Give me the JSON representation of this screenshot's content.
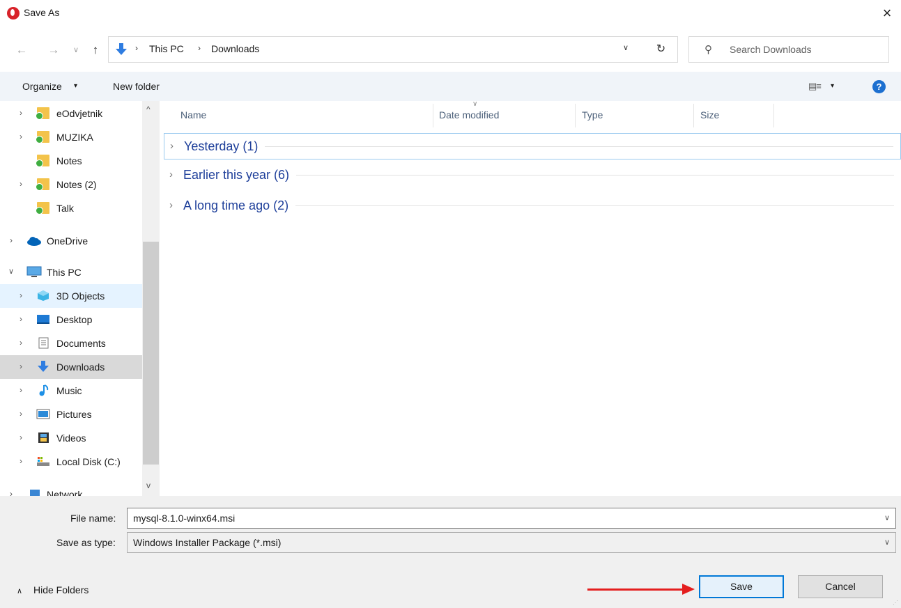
{
  "window": {
    "title": "Save As",
    "close_icon": "close-icon"
  },
  "nav": {
    "back_glyph": "←",
    "forward_glyph": "→",
    "recent_glyph": "∨",
    "up_glyph": "↑",
    "breadcrumb": [
      "This PC",
      "Downloads"
    ],
    "separator": "›",
    "dropdown_glyph": "∨",
    "refresh_glyph": "↻"
  },
  "search": {
    "placeholder": "Search Downloads",
    "icon": "search-icon"
  },
  "commandbar": {
    "organize_label": "Organize",
    "caret": "▾",
    "new_folder_label": "New folder",
    "help_label": "?",
    "view_icon": "view-options-icon"
  },
  "sidebar": {
    "items": [
      {
        "label": "eOdvjetnik",
        "chevron": "›",
        "icon": "shared-folder-icon"
      },
      {
        "label": "MUZIKA",
        "chevron": "›",
        "icon": "shared-folder-icon"
      },
      {
        "label": "Notes",
        "chevron": "",
        "icon": "shared-folder-icon"
      },
      {
        "label": "Notes (2)",
        "chevron": "›",
        "icon": "shared-folder-icon"
      },
      {
        "label": "Talk",
        "chevron": "",
        "icon": "shared-folder-icon"
      },
      {
        "label": "OneDrive",
        "chevron": "›",
        "icon": "cloud-icon"
      },
      {
        "label": "This PC",
        "chevron": "∨",
        "icon": "computer-icon"
      },
      {
        "label": "3D Objects",
        "chevron": "›",
        "icon": "cube-icon"
      },
      {
        "label": "Desktop",
        "chevron": "›",
        "icon": "desktop-icon"
      },
      {
        "label": "Documents",
        "chevron": "›",
        "icon": "document-icon"
      },
      {
        "label": "Downloads",
        "chevron": "›",
        "icon": "download-icon"
      },
      {
        "label": "Music",
        "chevron": "›",
        "icon": "music-icon"
      },
      {
        "label": "Pictures",
        "chevron": "›",
        "icon": "pictures-icon"
      },
      {
        "label": "Videos",
        "chevron": "›",
        "icon": "video-icon"
      },
      {
        "label": "Local Disk (C:)",
        "chevron": "›",
        "icon": "disk-icon"
      },
      {
        "label": "Network",
        "chevron": "›",
        "icon": "network-icon"
      }
    ],
    "scroll_up": "^",
    "scroll_down": "v"
  },
  "columns": {
    "name": "Name",
    "date": "Date modified",
    "type": "Type",
    "size": "Size",
    "sort_caret": "∨"
  },
  "groups": [
    {
      "label": "Yesterday (1)",
      "chevron": "›"
    },
    {
      "label": "Earlier this year (6)",
      "chevron": "›"
    },
    {
      "label": "A long time ago (2)",
      "chevron": "›"
    }
  ],
  "form": {
    "file_name_label": "File name:",
    "file_name_value": "mysql-8.1.0-winx64.msi",
    "save_type_label": "Save as type:",
    "save_type_value": "Windows Installer Package (*.msi)",
    "dropdown_glyph": "∨"
  },
  "footer": {
    "hide_folders_label": "Hide Folders",
    "hide_caret": "∧",
    "save_label": "Save",
    "cancel_label": "Cancel",
    "grip": "⋰"
  },
  "colors": {
    "accent": "#0078d7",
    "group_title": "#1e3f9a",
    "annotation_arrow": "#e41e1e",
    "selected_bg": "#cce8ff"
  }
}
